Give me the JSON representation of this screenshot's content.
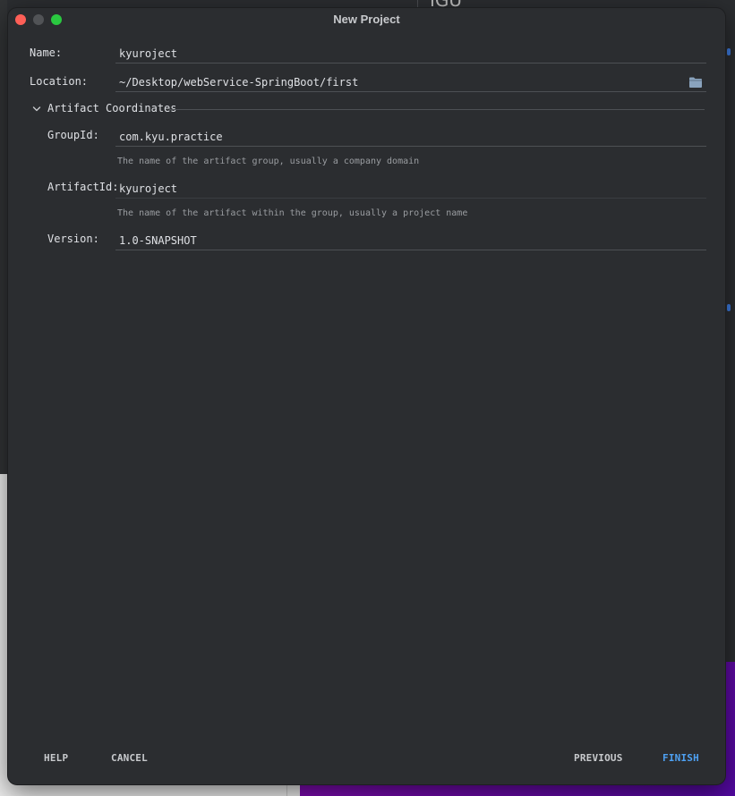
{
  "background": {
    "editor_glyph": "IGU"
  },
  "dialog": {
    "title": "New Project",
    "name": {
      "label": "Name:",
      "value": "kyuroject"
    },
    "location": {
      "label": "Location:",
      "value": "~/Desktop/webService-SpringBoot/first",
      "icon": "folder-icon"
    },
    "artifact_section": {
      "title": "Artifact Coordinates",
      "expanded": true,
      "icon": "chevron-down-icon",
      "group_id": {
        "label": "GroupId:",
        "value": "com.kyu.practice",
        "hint": "The name of the artifact group, usually a company domain"
      },
      "artifact_id": {
        "label": "ArtifactId:",
        "value": "kyuroject",
        "hint": "The name of the artifact within the group, usually a project name"
      },
      "version": {
        "label": "Version:",
        "value": "1.0-SNAPSHOT"
      }
    },
    "buttons": {
      "help": "HELP",
      "cancel": "CANCEL",
      "previous": "PREVIOUS",
      "finish": "FINISH"
    }
  },
  "colors": {
    "dialog_bg": "#2b2d30",
    "text": "#dfe1e5",
    "hint": "#9a9da1",
    "accent": "#4ea1f3",
    "close": "#fe5f57",
    "minimize_disabled": "#515356",
    "maximize": "#2ac840"
  }
}
